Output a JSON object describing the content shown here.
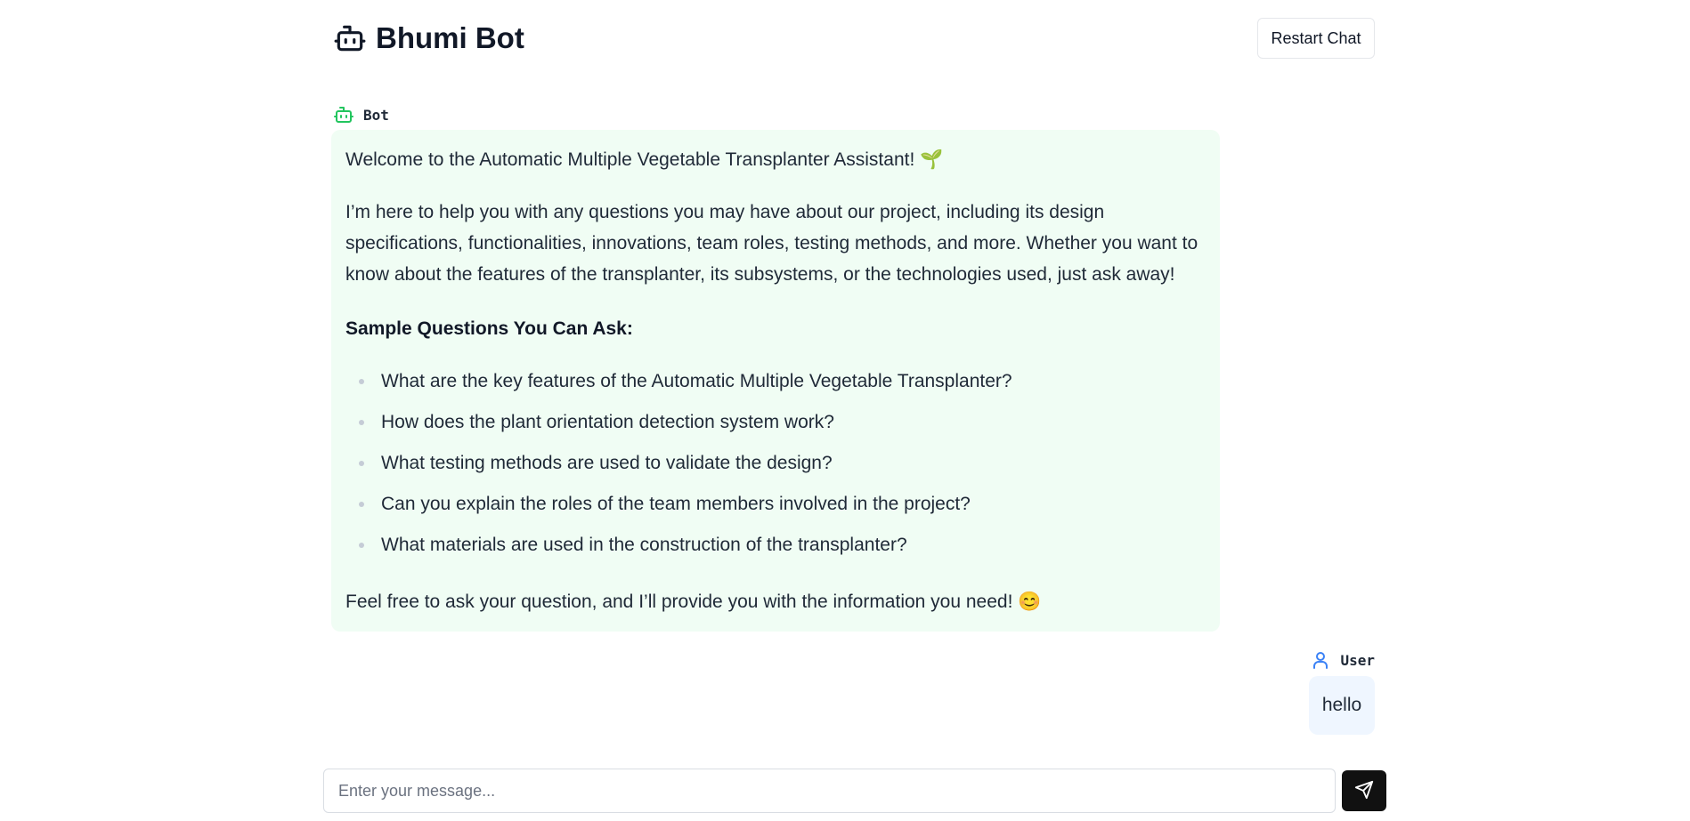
{
  "header": {
    "title": "Bhumi Bot",
    "logo_icon": "robot-icon",
    "restart_label": "Restart Chat"
  },
  "colors": {
    "bot_bubble_bg": "#f0fdf4",
    "bot_accent": "#22c55e",
    "user_bubble_bg": "#eff6ff",
    "user_accent": "#3b82f6",
    "send_button_bg": "#111111"
  },
  "messages": {
    "bot": {
      "sender": "Bot",
      "icon": "robot-icon",
      "welcome": "Welcome to the Automatic Multiple Vegetable Transplanter Assistant! 🌱",
      "intro": "I’m here to help you with any questions you may have about our project, including its design specifications, functionalities, innovations, team roles, testing methods, and more. Whether you want to know about the features of the transplanter, its subsystems, or the technologies used, just ask away!",
      "heading": "Sample Questions You Can Ask:",
      "questions": [
        "What are the key features of the Automatic Multiple Vegetable Transplanter?",
        "How does the plant orientation detection system work?",
        "What testing methods are used to validate the design?",
        "Can you explain the roles of the team members involved in the project?",
        "What materials are used in the construction of the transplanter?"
      ],
      "outro": "Feel free to ask your question, and I’ll provide you with the information you need! 😊"
    },
    "user": {
      "sender": "User",
      "icon": "user-icon",
      "text": "hello"
    }
  },
  "composer": {
    "placeholder": "Enter your message...",
    "value": "",
    "send_icon": "send-icon"
  }
}
